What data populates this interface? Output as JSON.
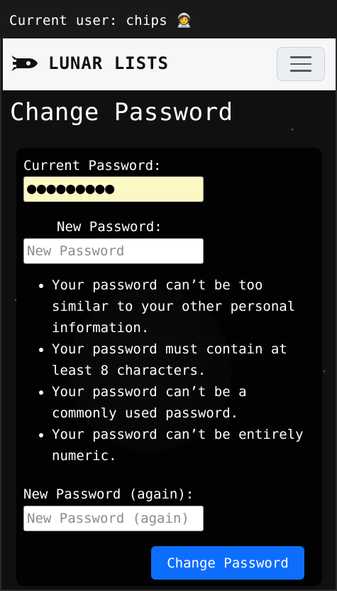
{
  "header": {
    "current_user_text": "Current user: chips 🧑‍🚀"
  },
  "navbar": {
    "brand": "LUNAR LISTS",
    "brand_icon": "rocket-icon",
    "toggler_icon": "hamburger-menu-icon"
  },
  "page": {
    "title": "Change Password"
  },
  "form": {
    "current_password": {
      "label": "Current Password:",
      "value": "●●●●●●●●●"
    },
    "new_password": {
      "label": "New Password:",
      "placeholder": "New Password"
    },
    "help_items": [
      "Your password can’t be too similar to your other personal information.",
      "Your password must contain at least 8 characters.",
      "Your password can’t be a commonly used password.",
      "Your password can’t be entirely numeric."
    ],
    "new_password_again": {
      "label": "New Password (again):",
      "placeholder": "New Password (again)"
    },
    "submit_label": "Change Password"
  },
  "colors": {
    "primary_button": "#0d6efd",
    "autofill_background": "#fcf8c3",
    "navbar_background": "#f6f7f9"
  }
}
